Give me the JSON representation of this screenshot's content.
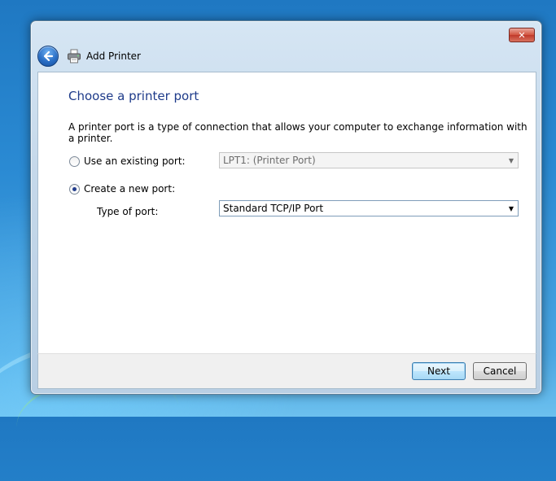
{
  "window": {
    "title": "Add Printer",
    "close_glyph": "✕"
  },
  "page": {
    "heading": "Choose a printer port",
    "description": "A printer port is a type of connection that allows your computer to exchange information with a printer."
  },
  "options": {
    "existing": {
      "label": "Use an existing port:",
      "selected": false,
      "value": "LPT1: (Printer Port)",
      "enabled": false
    },
    "create": {
      "label": "Create a new port:",
      "selected": true,
      "type_label": "Type of port:",
      "value": "Standard TCP/IP Port"
    }
  },
  "buttons": {
    "next": "Next",
    "cancel": "Cancel"
  },
  "icons": {
    "back": "back-arrow-icon",
    "printer": "printer-icon",
    "dropdown": "chevron-down-icon"
  },
  "colors": {
    "heading": "#1e3b8a",
    "close_button": "#c0392b",
    "desktop": "#2a8ad3"
  }
}
